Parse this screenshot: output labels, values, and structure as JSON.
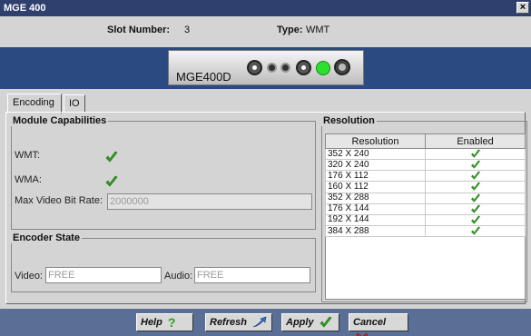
{
  "window": {
    "title": "MGE 400",
    "close_label": "×"
  },
  "info": {
    "slot_label": "Slot Number:",
    "slot_value": "3",
    "type_label": "Type:",
    "type_value": "WMT"
  },
  "module": {
    "name": "MGE400D"
  },
  "tabs": [
    {
      "label": "Encoding",
      "active": true
    },
    {
      "label": "IO",
      "active": false
    }
  ],
  "capabilities": {
    "title": "Module Capabilities",
    "wmt_label": "WMT:",
    "wma_label": "WMA:",
    "max_bitrate_label": "Max Video Bit Rate:",
    "max_bitrate_value": "2000000"
  },
  "encoder_state": {
    "title": "Encoder State",
    "video_label": "Video:",
    "video_value": "FREE",
    "audio_label": "Audio:",
    "audio_value": "FREE"
  },
  "resolution": {
    "title": "Resolution",
    "headers": [
      "Resolution",
      "Enabled"
    ],
    "rows": [
      "352 X 240",
      "320 X 240",
      "176 X 112",
      "160 X 112",
      "352 X 288",
      "176 X 144",
      "192 X 144",
      "384 X 288"
    ]
  },
  "buttons": {
    "help": "Help",
    "refresh": "Refresh",
    "apply": "Apply",
    "cancel": "Cancel"
  },
  "colors": {
    "title_bar": "#2f3f6e",
    "banner": "#2c4a82",
    "footer": "#5a6f96",
    "check_green": "#2e9e1e",
    "led_green": "#2ee02e",
    "cancel_red": "#e02020"
  }
}
